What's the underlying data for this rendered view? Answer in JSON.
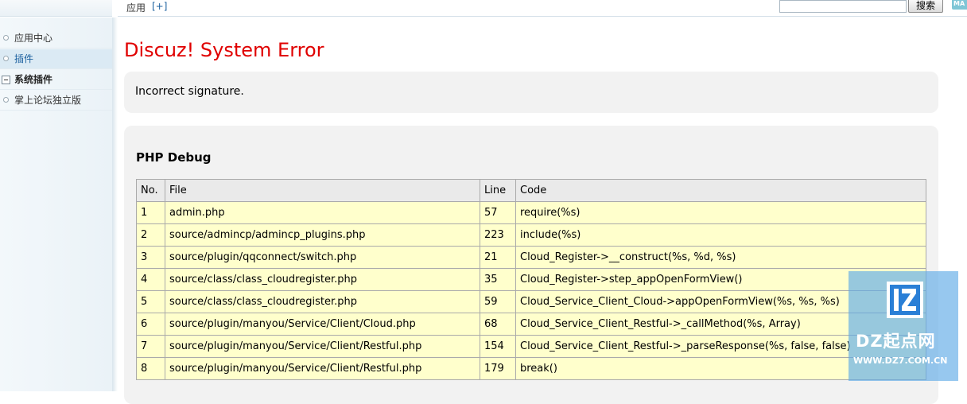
{
  "topbar": {
    "app_label": "应用",
    "add_link": "[+]",
    "search_placeholder": "",
    "search_button": "搜索",
    "map_badge": "MA"
  },
  "sidebar": {
    "items": [
      {
        "label": "应用中心",
        "type": "item",
        "active": false
      },
      {
        "label": "插件",
        "type": "item",
        "active": true
      },
      {
        "label": "系统插件",
        "type": "group",
        "active": false
      },
      {
        "label": "掌上论坛独立版",
        "type": "item",
        "active": false
      }
    ]
  },
  "error": {
    "title": "Discuz! System Error",
    "message": "Incorrect signature."
  },
  "debug": {
    "heading": "PHP Debug",
    "columns": [
      "No.",
      "File",
      "Line",
      "Code"
    ],
    "rows": [
      [
        "1",
        "admin.php",
        "57",
        "require(%s)"
      ],
      [
        "2",
        "source/admincp/admincp_plugins.php",
        "223",
        "include(%s)"
      ],
      [
        "3",
        "source/plugin/qqconnect/switch.php",
        "21",
        "Cloud_Register->__construct(%s, %d, %s)"
      ],
      [
        "4",
        "source/class/class_cloudregister.php",
        "35",
        "Cloud_Register->step_appOpenFormView()"
      ],
      [
        "5",
        "source/class/class_cloudregister.php",
        "59",
        "Cloud_Service_Client_Cloud->appOpenFormView(%s, %s, %s)"
      ],
      [
        "6",
        "source/plugin/manyou/Service/Client/Cloud.php",
        "68",
        "Cloud_Service_Client_Restful->_callMethod(%s, Array)"
      ],
      [
        "7",
        "source/plugin/manyou/Service/Client/Restful.php",
        "154",
        "Cloud_Service_Client_Restful->_parseResponse(%s, false, false)"
      ],
      [
        "8",
        "source/plugin/manyou/Service/Client/Restful.php",
        "179",
        "break()"
      ]
    ]
  },
  "watermark": {
    "name": "DZ起点网",
    "url": "WWW.DZ7.COM.CN"
  },
  "colors": {
    "error_title": "#e00000",
    "row_bg": "#ffffcc",
    "link": "#1a5f9e"
  }
}
